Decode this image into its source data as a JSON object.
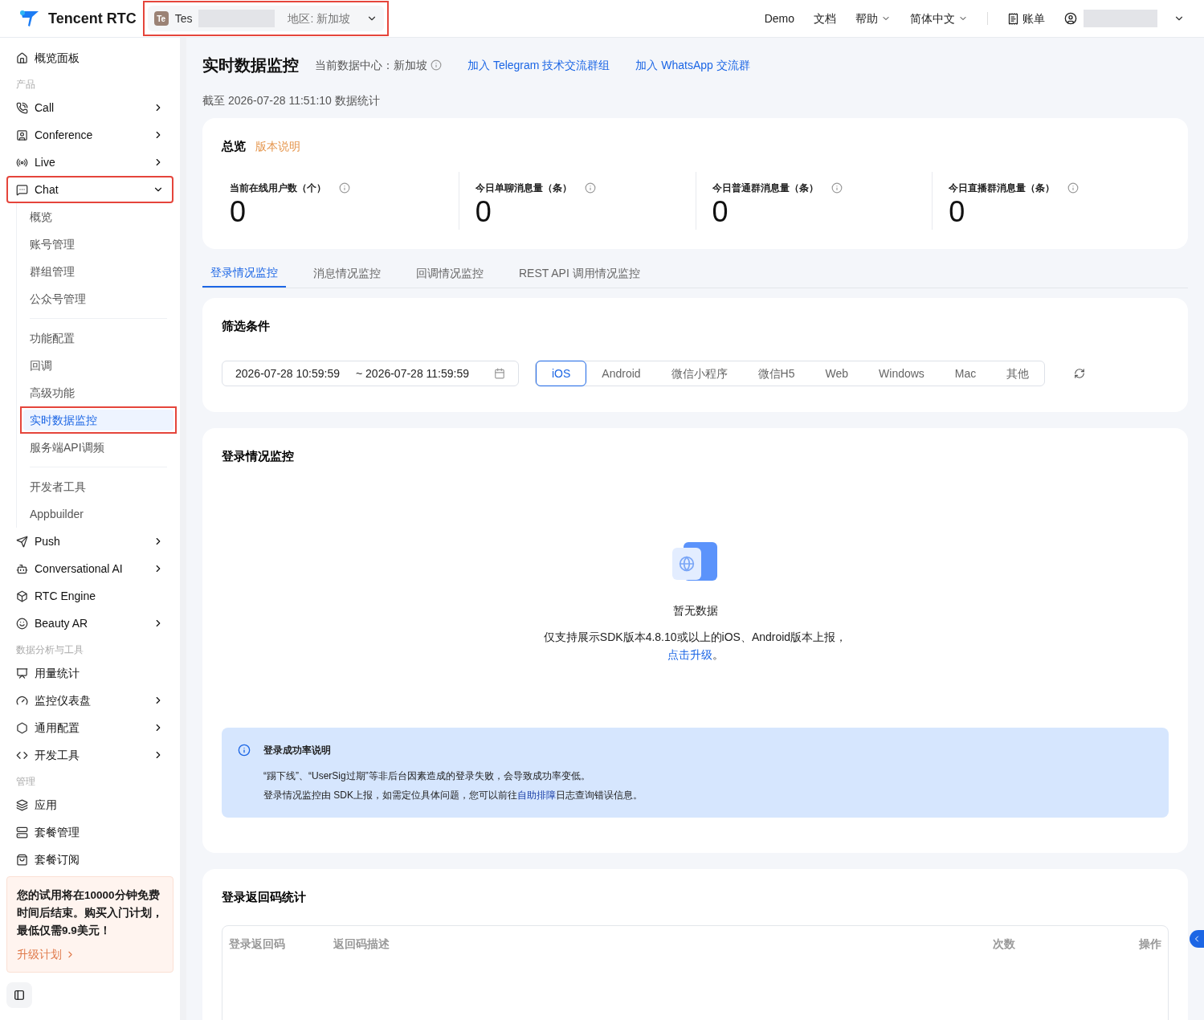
{
  "header": {
    "logo": "Tencent RTC",
    "project": {
      "badge": "Te",
      "name": "Tes",
      "region": "地区: 新加坡",
      "highlighted": true
    },
    "links": [
      {
        "label": "Demo",
        "dropdown": false
      },
      {
        "label": "文档",
        "dropdown": false
      },
      {
        "label": "帮助",
        "dropdown": true
      },
      {
        "label": "简体中文",
        "dropdown": true
      }
    ],
    "billing": "账单"
  },
  "sidebar": {
    "items": [
      {
        "kind": "item",
        "label": "概览面板"
      },
      {
        "kind": "section",
        "label": "产品"
      },
      {
        "kind": "item",
        "label": "Call",
        "expandable": true,
        "expanded": false
      },
      {
        "kind": "item",
        "label": "Conference",
        "expandable": true,
        "expanded": false
      },
      {
        "kind": "item",
        "label": "Live",
        "expandable": true,
        "expanded": false
      },
      {
        "kind": "item",
        "label": "Chat",
        "expandable": true,
        "expanded": true,
        "highlighted": true,
        "children": [
          {
            "kind": "sub",
            "label": "概览",
            "selected": false
          },
          {
            "kind": "sub",
            "label": "账号管理",
            "selected": false
          },
          {
            "kind": "sub",
            "label": "群组管理",
            "selected": false
          },
          {
            "kind": "sub",
            "label": "公众号管理",
            "selected": false
          },
          {
            "kind": "divider"
          },
          {
            "kind": "sub",
            "label": "功能配置",
            "selected": false
          },
          {
            "kind": "sub",
            "label": "回调",
            "selected": false
          },
          {
            "kind": "sub",
            "label": "高级功能",
            "selected": false
          },
          {
            "kind": "sub",
            "label": "实时数据监控",
            "selected": true,
            "highlighted": true
          },
          {
            "kind": "sub",
            "label": "服务端API调频",
            "selected": false
          },
          {
            "kind": "divider"
          },
          {
            "kind": "sub",
            "label": "开发者工具",
            "selected": false
          },
          {
            "kind": "sub",
            "label": "Appbuilder",
            "selected": false
          }
        ]
      },
      {
        "kind": "item",
        "label": "Push",
        "expandable": true,
        "expanded": false
      },
      {
        "kind": "item",
        "label": "Conversational AI",
        "expandable": true,
        "expanded": false
      },
      {
        "kind": "item",
        "label": "RTC Engine",
        "expandable": false
      },
      {
        "kind": "item",
        "label": "Beauty AR",
        "expandable": true,
        "expanded": false
      },
      {
        "kind": "section",
        "label": "数据分析与工具"
      },
      {
        "kind": "item",
        "label": "用量统计",
        "expandable": false
      },
      {
        "kind": "item",
        "label": "监控仪表盘",
        "expandable": true,
        "expanded": false
      },
      {
        "kind": "item",
        "label": "通用配置",
        "expandable": true,
        "expanded": false
      },
      {
        "kind": "item",
        "label": "开发工具",
        "expandable": true,
        "expanded": false
      },
      {
        "kind": "section",
        "label": "管理"
      },
      {
        "kind": "item",
        "label": "应用",
        "expandable": false
      },
      {
        "kind": "item",
        "label": "套餐管理",
        "expandable": false
      },
      {
        "kind": "item",
        "label": "套餐订阅",
        "expandable": false
      }
    ],
    "trial": {
      "text": "您的试用将在10000分钟免费时间后结束。购买入门计划，最低仅需9.9美元！",
      "link": "升级计划"
    }
  },
  "page": {
    "title": "实时数据监控",
    "datacenter": "当前数据中心：新加坡",
    "links": [
      "加入 Telegram 技术交流群组",
      "加入 WhatsApp 交流群"
    ],
    "updated": "截至 2026-07-28 11:51:10 数据统计"
  },
  "overview": {
    "title": "总览",
    "note": "版本说明",
    "stats": [
      {
        "label": "当前在线用户数（个）",
        "value": "0"
      },
      {
        "label": "今日单聊消息量（条）",
        "value": "0"
      },
      {
        "label": "今日普通群消息量（条）",
        "value": "0"
      },
      {
        "label": "今日直播群消息量（条）",
        "value": "0"
      }
    ]
  },
  "tabs": [
    {
      "label": "登录情况监控",
      "selected": true
    },
    {
      "label": "消息情况监控",
      "selected": false
    },
    {
      "label": "回调情况监控",
      "selected": false
    },
    {
      "label": "REST API 调用情况监控",
      "selected": false
    }
  ],
  "filter": {
    "title": "筛选条件",
    "start": "2026-07-28 10:59:59",
    "end": "~ 2026-07-28 11:59:59",
    "platforms": [
      {
        "label": "iOS",
        "selected": true
      },
      {
        "label": "Android",
        "selected": false
      },
      {
        "label": "微信小程序",
        "selected": false
      },
      {
        "label": "微信H5",
        "selected": false
      },
      {
        "label": "Web",
        "selected": false
      },
      {
        "label": "Windows",
        "selected": false
      },
      {
        "label": "Mac",
        "selected": false
      },
      {
        "label": "其他",
        "selected": false
      }
    ]
  },
  "login_monitor": {
    "title": "登录情况监控",
    "empty": "暂无数据",
    "note": "仅支持展示SDK版本4.8.10或以上的iOS、Android版本上报，",
    "note_link": "点击升级",
    "note_end": "。",
    "info": {
      "title": "登录成功率说明",
      "line1": "“踢下线”、“UserSig过期”等非后台因素造成的登录失败，会导致成功率变低。",
      "line2_before": "登录情况监控由 SDK上报，如需定位具体问题，您可以前往",
      "line2_link": "自助排障",
      "line2_after": "日志查询错误信息。"
    }
  },
  "return_codes": {
    "title": "登录返回码统计",
    "columns": [
      "登录返回码",
      "返回码描述",
      "次数",
      "操作"
    ]
  }
}
